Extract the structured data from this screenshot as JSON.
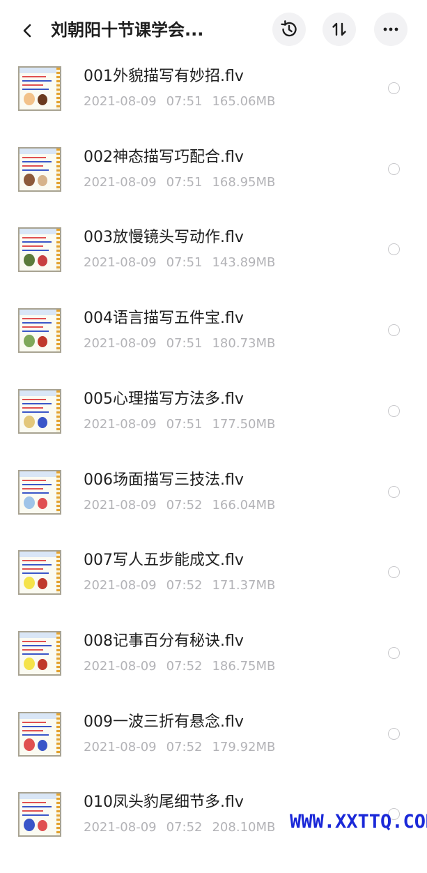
{
  "header": {
    "title": "刘朝阳十节课学会...",
    "back_icon": "chevron-left-icon",
    "history_icon": "history-icon",
    "sort_icon": "sort-icon",
    "more_icon": "more-dots-icon"
  },
  "files": [
    {
      "name": "001外貌描写有妙招.flv",
      "date": "2021-08-09",
      "time": "07:51",
      "size": "165.06MB"
    },
    {
      "name": "002神态描写巧配合.flv",
      "date": "2021-08-09",
      "time": "07:51",
      "size": "168.95MB"
    },
    {
      "name": "003放慢镜头写动作.flv",
      "date": "2021-08-09",
      "time": "07:51",
      "size": "143.89MB"
    },
    {
      "name": "004语言描写五件宝.flv",
      "date": "2021-08-09",
      "time": "07:51",
      "size": "180.73MB"
    },
    {
      "name": "005心理描写方法多.flv",
      "date": "2021-08-09",
      "time": "07:51",
      "size": "177.50MB"
    },
    {
      "name": "006场面描写三技法.flv",
      "date": "2021-08-09",
      "time": "07:52",
      "size": "166.04MB"
    },
    {
      "name": "007写人五步能成文.flv",
      "date": "2021-08-09",
      "time": "07:52",
      "size": "171.37MB"
    },
    {
      "name": "008记事百分有秘诀.flv",
      "date": "2021-08-09",
      "time": "07:52",
      "size": "186.75MB"
    },
    {
      "name": "009一波三折有悬念.flv",
      "date": "2021-08-09",
      "time": "07:52",
      "size": "179.92MB"
    },
    {
      "name": "010凤头豹尾细节多.flv",
      "date": "2021-08-09",
      "time": "07:52",
      "size": "208.10MB"
    }
  ],
  "watermark": "WWW.XXTTQ.COM",
  "colors": {
    "accent_watermark": "#1a28d8",
    "meta_text": "#b3b3b7",
    "check_border": "#c9c9cc"
  }
}
